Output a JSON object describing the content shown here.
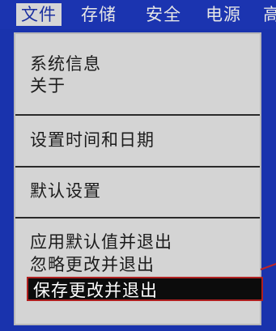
{
  "menubar": {
    "items": [
      {
        "label": "文件",
        "active": true
      },
      {
        "label": "存储",
        "active": false
      },
      {
        "label": "安全",
        "active": false
      },
      {
        "label": "电源",
        "active": false
      },
      {
        "label": "高",
        "active": false
      }
    ]
  },
  "dropdown": {
    "options": [
      {
        "label": "系统信息"
      },
      {
        "label": "关于"
      },
      {
        "label": "设置时间和日期"
      },
      {
        "label": "默认设置"
      },
      {
        "label": "应用默认值并退出"
      },
      {
        "label": "忽略更改并退出"
      },
      {
        "label": "保存更改并退出",
        "selected": true
      }
    ]
  },
  "colors": {
    "background": "#1933ad",
    "menu_panel": "#d4d4d4",
    "selected_bg": "#0c0c0c",
    "highlight_border": "#b02020"
  }
}
